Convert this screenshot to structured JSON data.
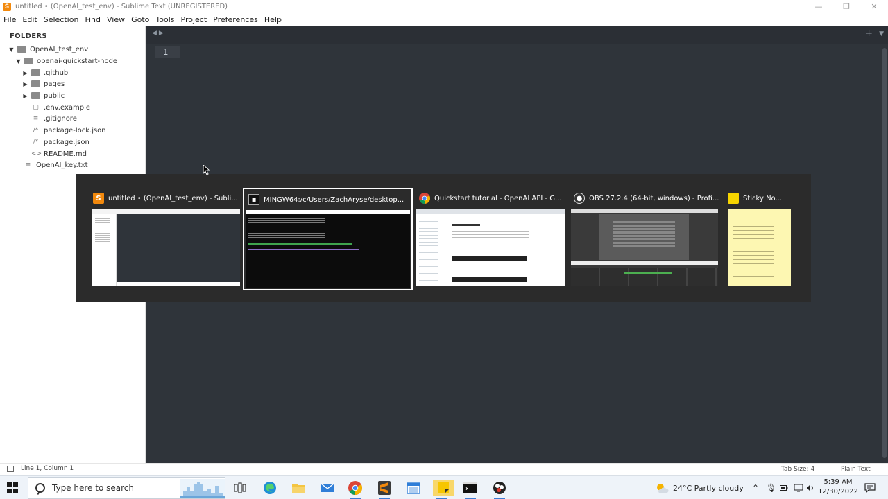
{
  "window": {
    "title": "untitled • (OpenAI_test_env) - Sublime Text (UNREGISTERED)",
    "minimize": "—",
    "restore": "❐",
    "close": "✕"
  },
  "menu": [
    "File",
    "Edit",
    "Selection",
    "Find",
    "View",
    "Goto",
    "Tools",
    "Project",
    "Preferences",
    "Help"
  ],
  "sidebar": {
    "header": "FOLDERS",
    "items": [
      {
        "label": "OpenAI_test_env",
        "type": "folder",
        "expanded": true
      },
      {
        "label": "openai-quickstart-node",
        "type": "folder",
        "expanded": true
      },
      {
        "label": ".github",
        "type": "folder",
        "expanded": false
      },
      {
        "label": "pages",
        "type": "folder",
        "expanded": false
      },
      {
        "label": "public",
        "type": "folder",
        "expanded": false
      },
      {
        "label": ".env.example",
        "type": "file",
        "icon": "doc-icon"
      },
      {
        "label": ".gitignore",
        "type": "file",
        "icon": "lines-icon"
      },
      {
        "label": "package-lock.json",
        "type": "file",
        "icon": "json-icon"
      },
      {
        "label": "package.json",
        "type": "file",
        "icon": "json-icon"
      },
      {
        "label": "README.md",
        "type": "file",
        "icon": "code-icon"
      },
      {
        "label": "OpenAI_key.txt",
        "type": "file",
        "icon": "lines-icon"
      }
    ]
  },
  "editor": {
    "line_number": "1"
  },
  "statusbar": {
    "position": "Line 1, Column 1",
    "tab_size": "Tab Size: 4",
    "syntax": "Plain Text"
  },
  "switcher": {
    "items": [
      {
        "title": "untitled • (OpenAI_test_env) - Subli...",
        "icon": "sublime-icon",
        "selected": false
      },
      {
        "title": "MINGW64:/c/Users/ZachAryse/desktop...",
        "icon": "terminal-icon",
        "selected": true
      },
      {
        "title": "Quickstart tutorial - OpenAI API - G...",
        "icon": "chrome-icon",
        "selected": false
      },
      {
        "title": "OBS 27.2.4 (64-bit, windows) - Profi...",
        "icon": "obs-icon",
        "selected": false
      },
      {
        "title": "Sticky No...",
        "icon": "sticky-notes-icon",
        "selected": false
      }
    ]
  },
  "taskbar": {
    "search_placeholder": "Type here to search",
    "weather": "24°C  Partly cloudy",
    "time": "5:39 AM",
    "date": "12/30/2022"
  },
  "colors": {
    "editor_bg": "#2f343a",
    "switcher_bg": "#2b2b2b",
    "sublime_orange": "#f2890d",
    "taskbar_bg": "#eef3f9"
  }
}
